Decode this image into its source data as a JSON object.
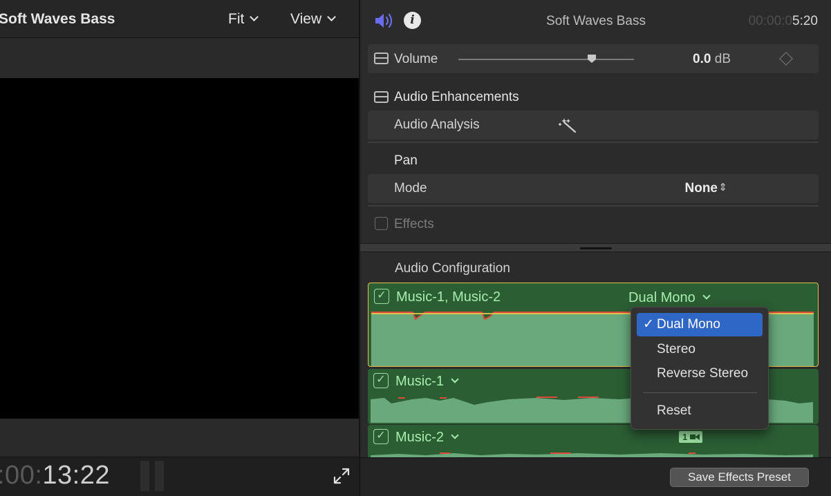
{
  "viewer": {
    "title": "Soft Waves Bass",
    "fit_label": "Fit",
    "view_label": "View",
    "timecode_dim": ":00:",
    "timecode_bright": "13:22"
  },
  "inspector": {
    "title": "Soft Waves Bass",
    "timecode_dim": "00:00:0",
    "timecode_bright": "5:20",
    "volume": {
      "label": "Volume",
      "value": "0.0",
      "unit": "dB",
      "slider_level": 0.76
    },
    "audio_enhancements": {
      "label": "Audio Enhancements",
      "analysis_label": "Audio Analysis"
    },
    "pan": {
      "label": "Pan",
      "mode_label": "Mode",
      "mode_value": "None"
    },
    "effects_label": "Effects",
    "audio_configuration_label": "Audio Configuration",
    "channels": [
      {
        "name": "Music-1, Music-2",
        "mode": "Dual Mono",
        "checked": true
      },
      {
        "name": "Music-1",
        "checked": true
      },
      {
        "name": "Music-2",
        "checked": true,
        "badge": "1"
      }
    ],
    "save_preset_label": "Save Effects Preset"
  },
  "popup_menu": {
    "items": [
      {
        "label": "Dual Mono",
        "checkmark": "✓",
        "selected": true
      },
      {
        "label": "Stereo",
        "selected": false
      },
      {
        "label": "Reverse Stereo",
        "selected": false
      },
      {
        "label": "Reset",
        "selected": false
      }
    ]
  },
  "colors": {
    "accent_blue": "#2f67c7",
    "speaker_icon": "#6a6cf0",
    "channel_green": "#2b5e33",
    "waveform_fill": "#6aa97c",
    "channel_text": "#a7eeae",
    "selection_outline": "#e7c24a"
  }
}
